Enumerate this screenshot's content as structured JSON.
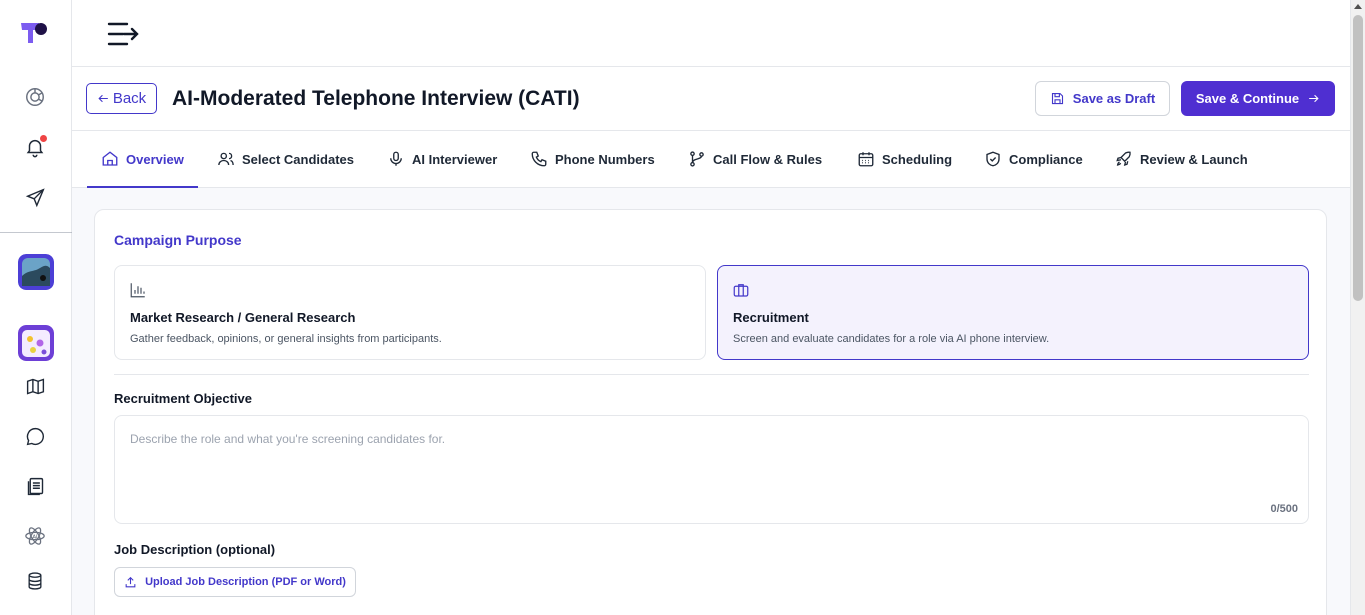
{
  "app": {
    "logo": "brand-logo"
  },
  "rail": {
    "icons": [
      "dashboard-icon",
      "bell-icon",
      "send-icon",
      "app-thumbnail-1",
      "app-thumbnail-2",
      "map-icon",
      "chat-icon",
      "document-icon",
      "ai-icon",
      "database-icon"
    ]
  },
  "header": {
    "back_label": "Back",
    "title": "AI-Moderated Telephone Interview (CATI)",
    "save_draft_label": "Save as Draft",
    "save_continue_label": "Save & Continue"
  },
  "tabs": [
    {
      "label": "Overview",
      "icon": "home-icon",
      "active": true
    },
    {
      "label": "Select Candidates",
      "icon": "users-icon"
    },
    {
      "label": "AI Interviewer",
      "icon": "microphone-icon"
    },
    {
      "label": "Phone Numbers",
      "icon": "phone-icon"
    },
    {
      "label": "Call Flow & Rules",
      "icon": "branch-icon"
    },
    {
      "label": "Scheduling",
      "icon": "calendar-icon"
    },
    {
      "label": "Compliance",
      "icon": "shield-icon"
    },
    {
      "label": "Review & Launch",
      "icon": "rocket-icon"
    }
  ],
  "campaign": {
    "title": "Campaign Purpose",
    "options": [
      {
        "title": "Market Research / General Research",
        "desc": "Gather feedback, opinions, or general insights from participants.",
        "icon": "bar-chart-icon",
        "selected": false
      },
      {
        "title": "Recruitment",
        "desc": "Screen and evaluate candidates for a role via AI phone interview.",
        "icon": "briefcase-icon",
        "selected": true
      }
    ],
    "objective_label": "Recruitment Objective",
    "objective_placeholder": "Describe the role and what you're screening candidates for.",
    "objective_counter": "0/500",
    "job_desc_label": "Job Description (optional)",
    "upload_label": "Upload Job Description (PDF or Word)"
  },
  "colors": {
    "accent": "#4338ca",
    "primary_button": "#4f2fd1",
    "notification": "#ef4444"
  }
}
